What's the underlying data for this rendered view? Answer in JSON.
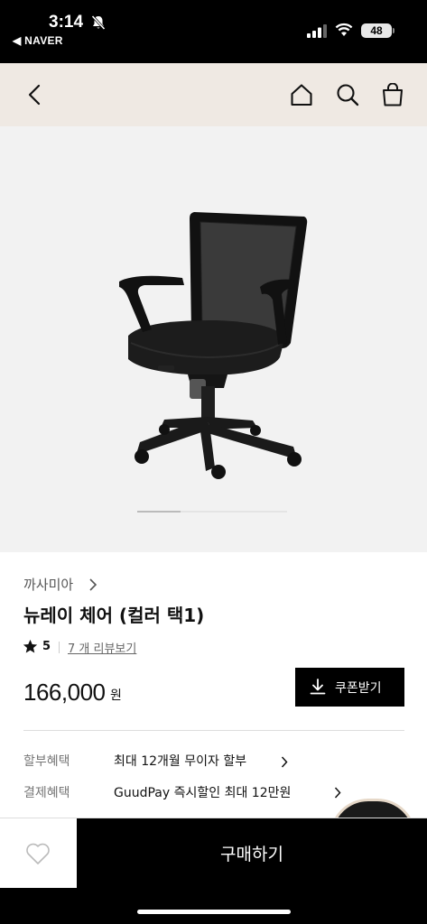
{
  "status_bar": {
    "time": "3:14",
    "back_app": "◀ NAVER",
    "battery": "48"
  },
  "header": {
    "icons": [
      "back-chevron-icon",
      "home-icon",
      "search-icon",
      "shopping-bag-icon"
    ]
  },
  "product_image": {
    "carousel_pages": 4,
    "carousel_active_index": 0
  },
  "product": {
    "brand": "까사미아",
    "title": "뉴레이 체어 (컬러 택1)",
    "rating": "5",
    "reviews_link": "7 개 리뷰보기",
    "price": "166,000",
    "currency": "원",
    "coupon_button": "쿠폰받기"
  },
  "benefits": [
    {
      "label": "할부혜택",
      "value": "최대 12개월 무이자 할부"
    },
    {
      "label": "결제혜택",
      "value": "GuudPay 즉시할인 최대 12만원"
    }
  ],
  "bottom_bar": {
    "buy_button": "구매하기"
  },
  "colors": {
    "header_bg": "#efe9e3",
    "image_bg": "#f2f2f2",
    "primary": "#000000"
  }
}
